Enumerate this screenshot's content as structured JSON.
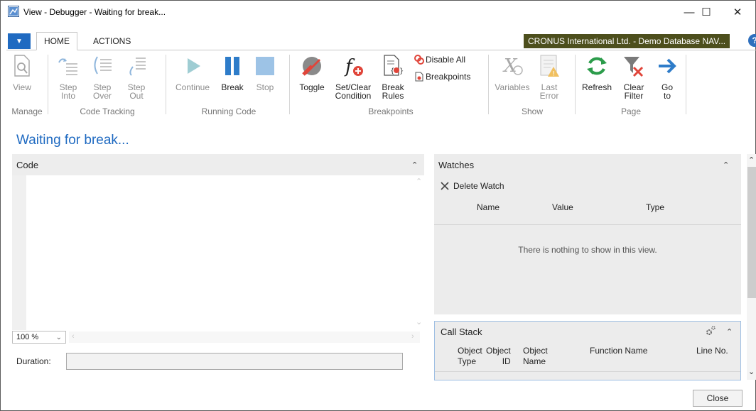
{
  "window": {
    "title": "View - Debugger - Waiting for break...",
    "minimize": "—",
    "maximize": "☐",
    "close": "✕"
  },
  "tabs": [
    {
      "label": "HOME",
      "active": true
    },
    {
      "label": "ACTIONS",
      "active": false
    }
  ],
  "company": "CRONUS International Ltd. - Demo Database NAV...",
  "help": "?",
  "ribbon": {
    "manage": {
      "label": "Manage",
      "view": "View"
    },
    "code_tracking": {
      "label": "Code Tracking",
      "step_into": [
        "Step",
        "Into"
      ],
      "step_over": [
        "Step",
        "Over"
      ],
      "step_out": [
        "Step",
        "Out"
      ]
    },
    "running_code": {
      "label": "Running Code",
      "continue": "Continue",
      "break": "Break",
      "stop": "Stop"
    },
    "breakpoints": {
      "label": "Breakpoints",
      "toggle": "Toggle",
      "set_clear": [
        "Set/Clear",
        "Condition"
      ],
      "break_rules": [
        "Break",
        "Rules"
      ],
      "disable_all": "Disable All",
      "breakpoints": "Breakpoints"
    },
    "show": {
      "label": "Show",
      "variables": "Variables",
      "last_error": [
        "Last",
        "Error"
      ]
    },
    "page": {
      "label": "Page",
      "refresh": "Refresh",
      "clear_filter": [
        "Clear",
        "Filter"
      ],
      "go_to": [
        "Go",
        "to"
      ]
    }
  },
  "page_title": "Waiting for break...",
  "code": {
    "header": "Code",
    "zoom": "100 %",
    "duration_label": "Duration:",
    "duration_value": ""
  },
  "watches": {
    "header": "Watches",
    "delete": "Delete Watch",
    "columns": [
      "Name",
      "Value",
      "Type"
    ],
    "empty": "There is nothing to show in this view."
  },
  "call_stack": {
    "header": "Call Stack",
    "columns": [
      [
        "Object",
        "Type"
      ],
      [
        "Object",
        "ID"
      ],
      [
        "Object",
        "Name"
      ],
      [
        "Function Name"
      ],
      [
        "Line No."
      ]
    ]
  },
  "close_button": "Close",
  "colors": {
    "accent": "#1f6ac1",
    "company_bg": "#4d4f1d",
    "pause_blue": "#2e7cc9",
    "play_teal": "#6ab1bb",
    "refresh_green": "#2c9c4b",
    "error_red": "#e0453a"
  }
}
